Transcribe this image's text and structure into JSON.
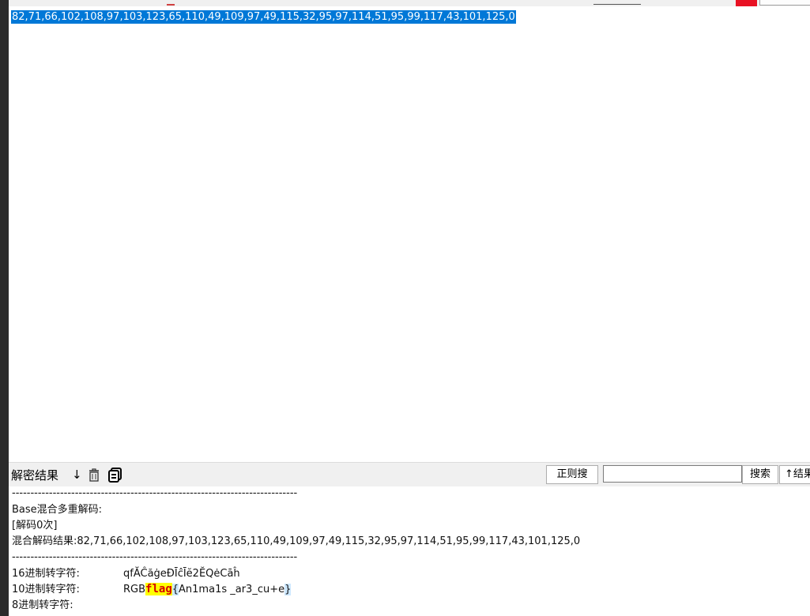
{
  "input": {
    "text": "82,71,66,102,108,97,103,123,65,110,49,109,97,49,115,32,95,97,114,51,95,99,117,43,101,125,0"
  },
  "result_bar": {
    "label": "解密结果",
    "arrow": "↓",
    "regex_label": "正则搜",
    "search_value": "",
    "search_label": "搜索",
    "result_up_label": "↑结果"
  },
  "output": {
    "separator": "-----------------------------------------------------------------------------",
    "base_title": "Base混合多重解码:",
    "decode_count": "[解码0次]",
    "mixed_result": "混合解码结果:82,71,66,102,108,97,103,123,65,110,49,109,97,49,115,32,95,97,114,51,95,99,117,43,101,125,0",
    "separator2": "-----------------------------------------------------------------------------",
    "hex_label": "16进制转字符:",
    "hex_value": "qfĂĈăġeĐĪĉĪĕ2ĔQėCāĥ",
    "dec_label": "10进制转字符:",
    "dec_prefix": "RGB",
    "dec_flag": "flag",
    "dec_open": "{",
    "dec_body": "An1ma1s _ar3_cu+e",
    "dec_close": "}",
    "oct_label": "8进制转字符:"
  },
  "icons": {
    "arrow": "arrow-down-icon",
    "trash": "trash-icon",
    "copy": "copy-icon"
  },
  "colors": {
    "selection": "#0078d7",
    "flag_highlight": "#ffff00",
    "flag_text": "#d40000",
    "close_red": "#e81123"
  }
}
